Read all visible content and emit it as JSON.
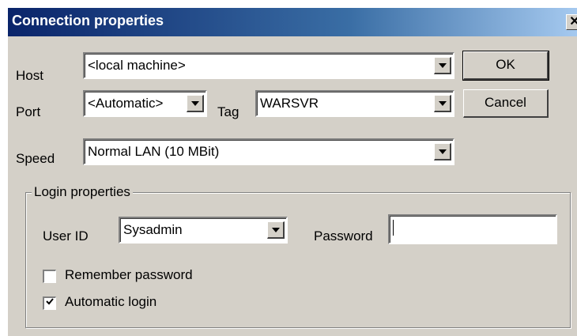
{
  "window": {
    "title": "Connection properties",
    "close_glyph": "✕",
    "close_icon": "close-icon"
  },
  "host": {
    "label": "Host",
    "value": "<local machine>"
  },
  "port": {
    "label": "Port",
    "value": "<Automatic>"
  },
  "tag": {
    "label": "Tag",
    "value": "WARSVR"
  },
  "speed": {
    "label": "Speed",
    "value": "Normal LAN (10 MBit)"
  },
  "buttons": {
    "ok": "OK",
    "cancel": "Cancel"
  },
  "login": {
    "group_label": "Login properties",
    "user_id_label": "User ID",
    "user_id_value": "Sysadmin",
    "password_label": "Password",
    "password_value": "",
    "remember_label": "Remember password",
    "remember_checked": false,
    "auto_label": "Automatic login",
    "auto_checked": true
  },
  "colors": {
    "face": "#d4d0c8",
    "title_start": "#0a246a",
    "title_end": "#a6caf0"
  }
}
